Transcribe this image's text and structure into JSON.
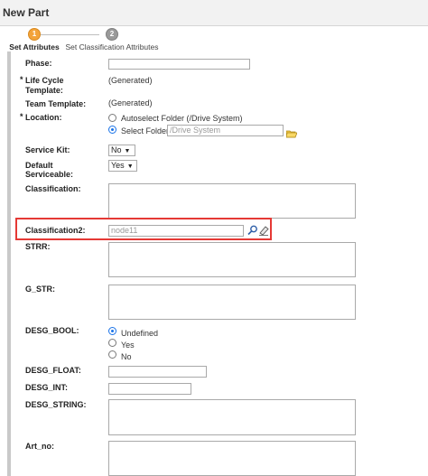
{
  "window": {
    "title": "New Part"
  },
  "steps": [
    {
      "number": "1",
      "label": "Set Attributes"
    },
    {
      "number": "2",
      "label": "Set Classification Attributes"
    }
  ],
  "form": {
    "phase": {
      "label": "Phase:",
      "value": ""
    },
    "lifecycle": {
      "label_line1": "Life Cycle",
      "label_line2": "Template:",
      "value": "(Generated)",
      "required_mark": "*"
    },
    "team_template": {
      "label": "Team Template:",
      "value": "(Generated)"
    },
    "location": {
      "label": "Location:",
      "required_mark": "*",
      "option_auto": "Autoselect Folder (/Drive System)",
      "option_select": "Select Folder",
      "folder_value": "/Drive System",
      "selected": "select"
    },
    "service_kit": {
      "label": "Service Kit:",
      "value": "No"
    },
    "default_serviceable": {
      "label_line1": "Default",
      "label_line2": "Serviceable:",
      "value": "Yes"
    },
    "classification": {
      "label": "Classification:",
      "value": ""
    },
    "classification2": {
      "label": "Classification2:",
      "value": "node11"
    },
    "strr": {
      "label": "STRR:",
      "value": ""
    },
    "g_str": {
      "label": "G_STR:",
      "value": ""
    },
    "desg_bool": {
      "label": "DESG_BOOL:",
      "options": [
        "Undefined",
        "Yes",
        "No"
      ],
      "selected": "Undefined"
    },
    "desg_float": {
      "label": "DESG_FLOAT:",
      "value": ""
    },
    "desg_int": {
      "label": "DESG_INT:",
      "value": ""
    },
    "desg_string": {
      "label": "DESG_STRING:",
      "value": ""
    },
    "art_no": {
      "label": "Art_no:",
      "value": ""
    }
  }
}
